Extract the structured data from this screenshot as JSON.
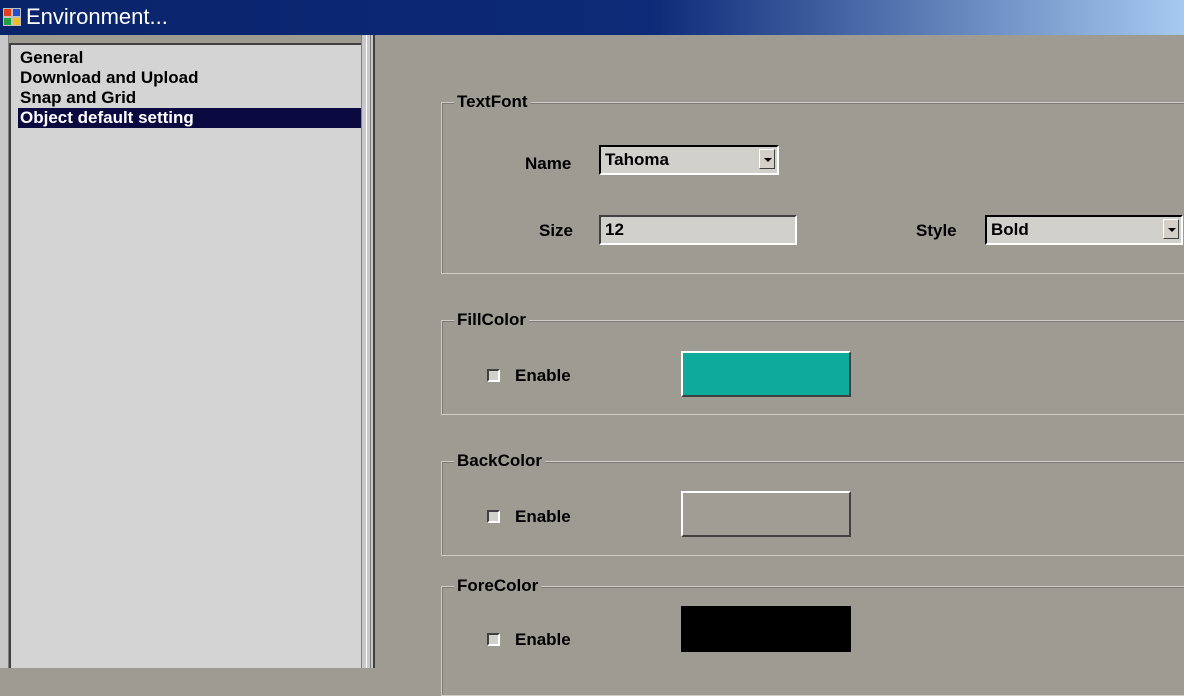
{
  "window": {
    "title": "Environment..."
  },
  "sidebar": {
    "items": [
      {
        "label": "General"
      },
      {
        "label": "Download and Upload"
      },
      {
        "label": "Snap and Grid"
      },
      {
        "label": "Object default setting"
      }
    ],
    "selected_index": 3
  },
  "textfont": {
    "group_label": "TextFont",
    "name_label": "Name",
    "name_value": "Tahoma",
    "size_label": "Size",
    "size_value": "12",
    "style_label": "Style",
    "style_value": "Bold"
  },
  "fillcolor": {
    "group_label": "FillColor",
    "enable_label": "Enable",
    "enabled": false,
    "color": "#0cab9b"
  },
  "backcolor": {
    "group_label": "BackColor",
    "enable_label": "Enable",
    "enabled": false,
    "color": "#a09d95"
  },
  "forecolor": {
    "group_label": "ForeColor",
    "enable_label": "Enable",
    "enabled": false,
    "color": "#000000"
  },
  "colors": {
    "titlebar_start": "#0a246a",
    "selection": "#0a0a40",
    "dialog_background": "#9e9b93"
  },
  "icons": {
    "title_icon": "window-app-icon"
  }
}
